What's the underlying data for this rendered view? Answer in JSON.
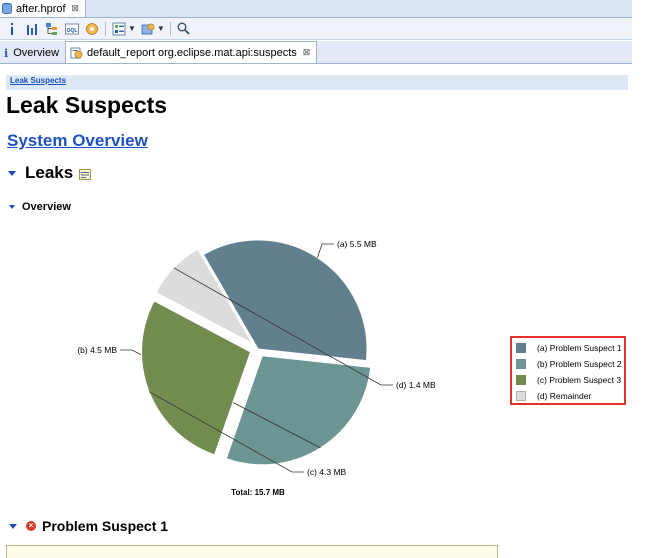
{
  "editor_tab": {
    "title": "after.hprof",
    "close": "⊠"
  },
  "toolbar": {
    "icons": [
      "info-icon",
      "histogram-icon",
      "dominator-tree-icon",
      "oql-icon",
      "heap-dump-overview-icon",
      "query-browser-icon",
      "find-object-icon",
      "search-icon"
    ]
  },
  "report_tabs": [
    {
      "label": "Overview",
      "prefix": "i"
    },
    {
      "label": "default_report  org.eclipse.mat.api:suspects",
      "close": "⊠"
    }
  ],
  "content": {
    "breadcrumb": "Leak Suspects",
    "title": "Leak Suspects",
    "system_overview": "System Overview",
    "leaks_heading": "Leaks",
    "overview_heading": "Overview",
    "problem_suspect_heading": "Problem Suspect 1"
  },
  "chart_data": {
    "type": "pie",
    "total_label": "Total: 15.7 MB",
    "slices": [
      {
        "label": "(a)  5.5 MB",
        "legend": "(a)  Problem Suspect 1",
        "value": 5.5,
        "color": "#627f8d",
        "exploded": false
      },
      {
        "label": "(b)  4.5 MB",
        "legend": "(b)  Problem Suspect 2",
        "value": 4.5,
        "color": "#6c9594",
        "exploded": true
      },
      {
        "label": "(c)  4.3 MB",
        "legend": "(c)  Problem Suspect 3",
        "value": 4.3,
        "color": "#728b4f",
        "exploded": true
      },
      {
        "label": "(d)  1.4 MB",
        "legend": "(d)  Remainder",
        "value": 1.4,
        "color": "#dcdcdc",
        "exploded": true
      }
    ],
    "legend_position": "right",
    "legend_highlight_color": "#e0312a"
  }
}
